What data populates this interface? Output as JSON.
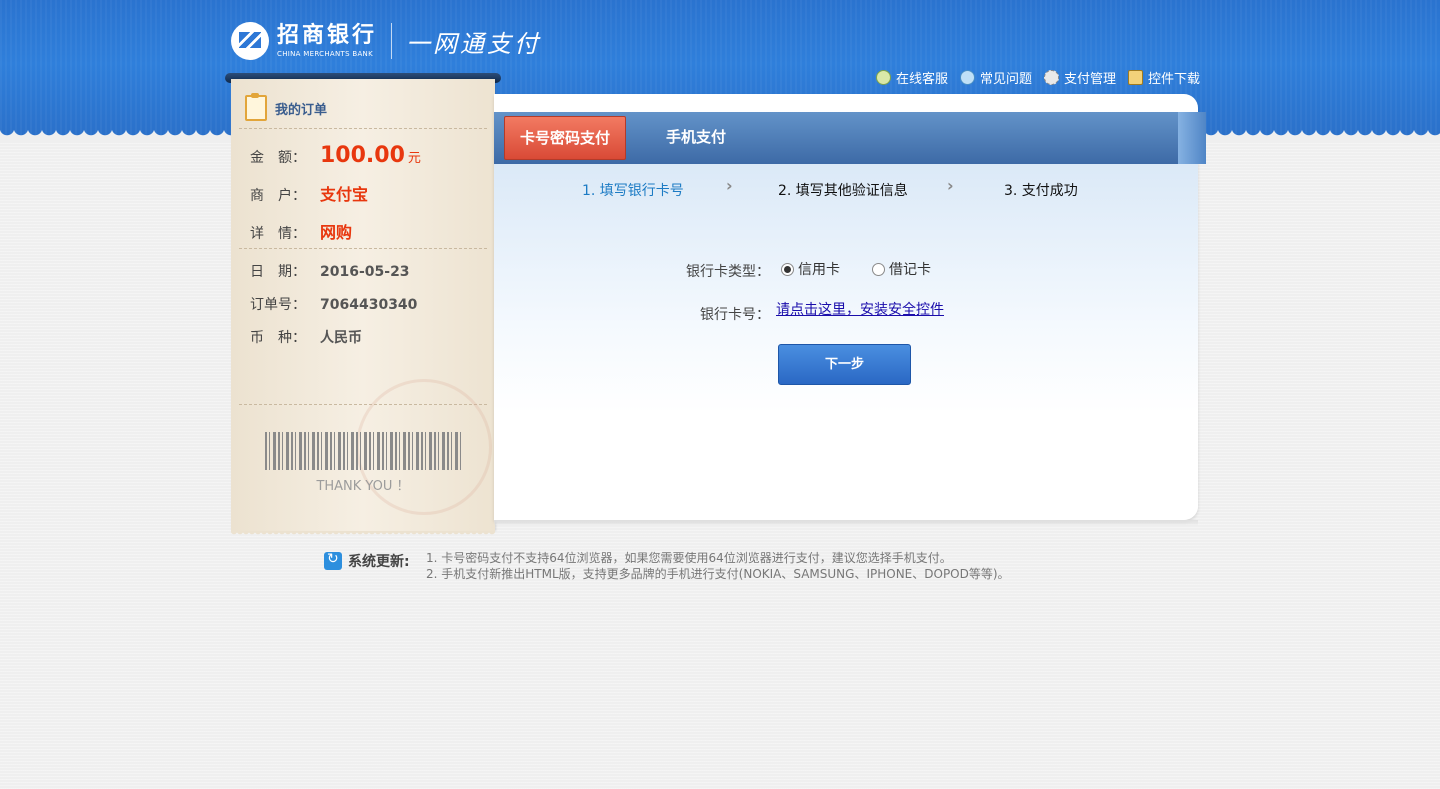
{
  "brand": {
    "cn": "招商银行",
    "en": "CHINA MERCHANTS BANK",
    "product": "一网通支付"
  },
  "top_links": [
    {
      "label": "在线客服",
      "icon": "chat-icon"
    },
    {
      "label": "常见问题",
      "icon": "help-icon"
    },
    {
      "label": "支付管理",
      "icon": "gear-icon"
    },
    {
      "label": "控件下载",
      "icon": "download-icon"
    }
  ],
  "order": {
    "title": "我的订单",
    "amount_label": "金　额：",
    "amount": "100.00",
    "amount_unit": "元",
    "merchant_label": "商　户：",
    "merchant": "支付宝",
    "detail_label": "详　情：",
    "detail": "网购",
    "date_label": "日　期：",
    "date": "2016-05-23",
    "order_no_label": "订单号：",
    "order_no": "7064430340",
    "currency_label": "币　种：",
    "currency": "人民币",
    "thanks": "THANK YOU ！"
  },
  "tabs": [
    "卡号密码支付",
    "手机支付"
  ],
  "steps": [
    "1. 填写银行卡号",
    "2. 填写其他验证信息",
    "3. 支付成功"
  ],
  "form": {
    "card_type_label": "银行卡类型：",
    "card_type_options": [
      "信用卡",
      "借记卡"
    ],
    "card_type_selected": "信用卡",
    "card_no_label": "银行卡号：",
    "install_link": "请点击这里，安装安全控件",
    "next_button": "下一步"
  },
  "notice": {
    "title": "系统更新:",
    "lines": [
      "1. 卡号密码支付不支持64位浏览器，如果您需要使用64位浏览器进行支付，建议您选择手机支付。",
      "2. 手机支付新推出HTML版，支持更多品牌的手机进行支付(NOKIA、SAMSUNG、IPHONE、DOPOD等等)。"
    ]
  }
}
